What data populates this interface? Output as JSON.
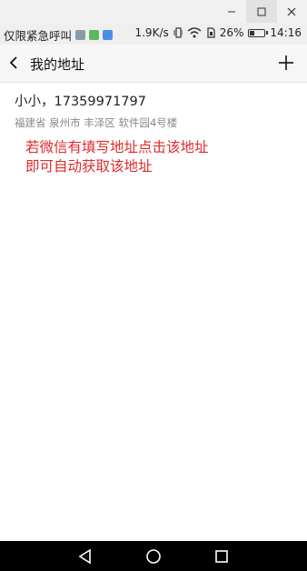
{
  "status": {
    "carrier": "仅限紧急呼叫",
    "speed": "1.9K/s",
    "battery_percent": "26%",
    "battery_level": 0.26,
    "time": "14:16"
  },
  "header": {
    "title": "我的地址"
  },
  "address": {
    "name_phone": "小小，17359971797",
    "detail": "福建省 泉州市 丰泽区 软件园4号楼"
  },
  "note": {
    "line1": "若微信有填写地址点击该地址",
    "line2": "即可自动获取该地址"
  },
  "colors": {
    "note": "#e02b2b",
    "nav_bar": "#000000"
  }
}
